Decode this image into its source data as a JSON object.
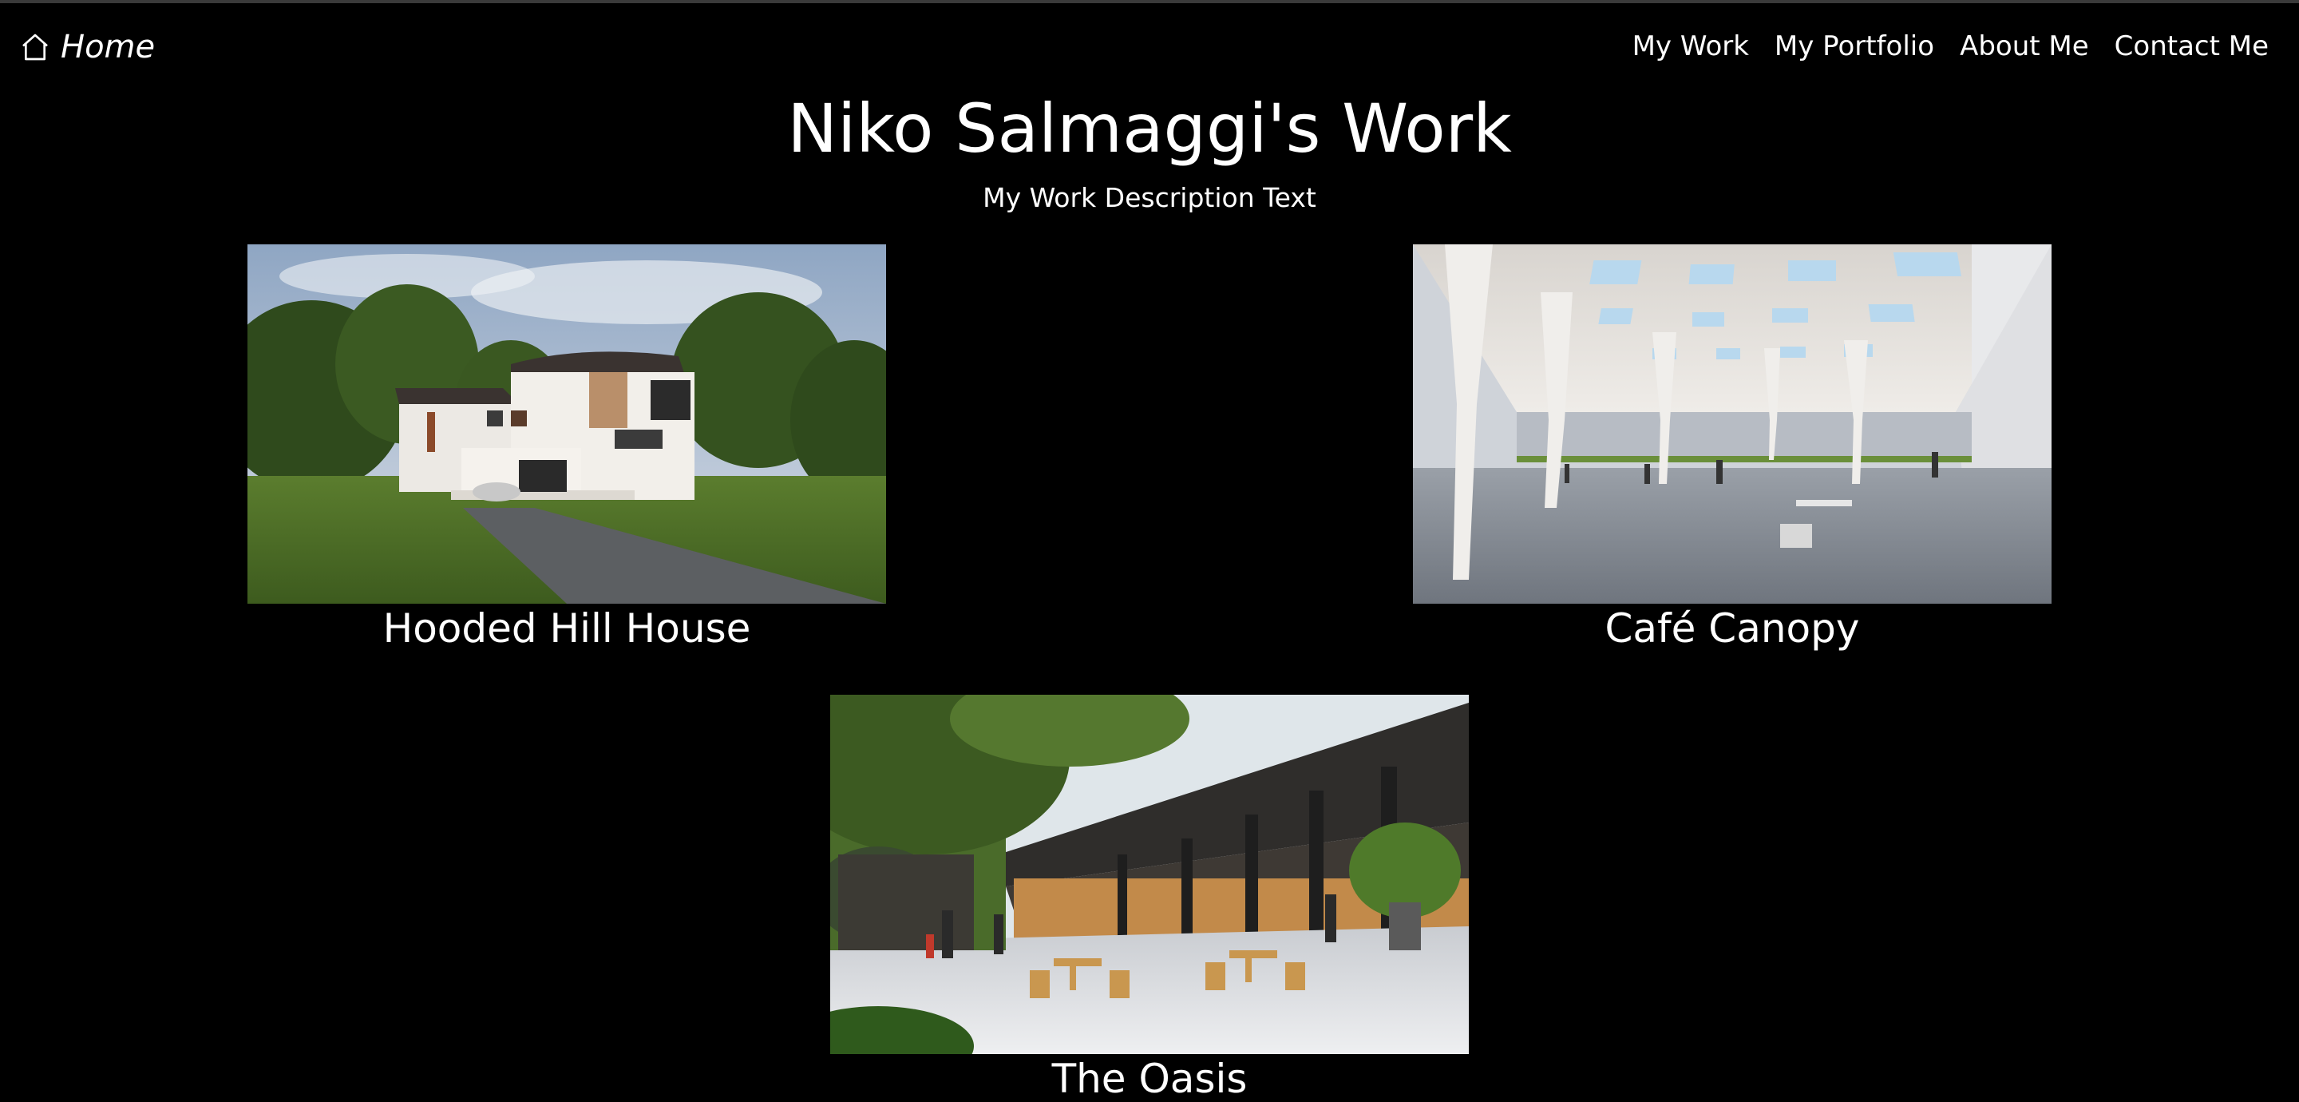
{
  "nav": {
    "home_label": "Home",
    "links": [
      "My Work",
      "My Portfolio",
      "About Me",
      "Contact Me"
    ]
  },
  "header": {
    "title": "Niko Salmaggi's Work",
    "subtitle": "My Work Description Text"
  },
  "projects": [
    {
      "title": "Hooded Hill House",
      "image": "house-render"
    },
    {
      "title": "Café Canopy",
      "image": "canopy-render"
    },
    {
      "title": "The Oasis",
      "image": "courtyard-render"
    }
  ]
}
